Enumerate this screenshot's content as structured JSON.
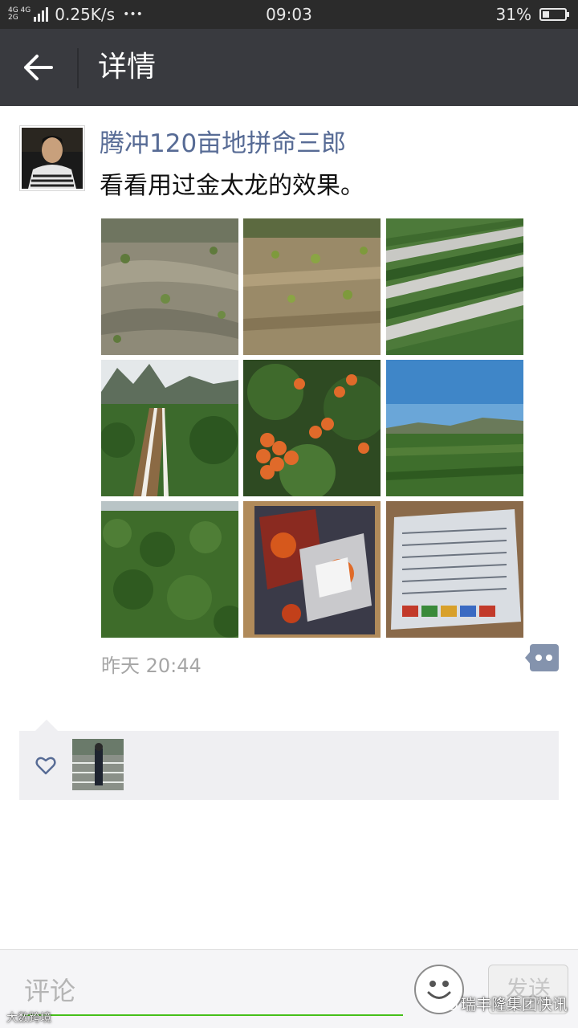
{
  "status_bar": {
    "network_top": "4G 4G",
    "network_bottom": "2G",
    "speed": "0.25K/s",
    "dots": "•••",
    "time": "09:03",
    "battery_percent": "31%",
    "battery_level": 0.31
  },
  "titlebar": {
    "back_icon": "arrow-left-icon",
    "title": "详情"
  },
  "post": {
    "author": "腾冲120亩地拼命三郎",
    "text": "看看用过金太龙的效果。",
    "photos": [
      {
        "label": "seedling field 1"
      },
      {
        "label": "seedling field 2"
      },
      {
        "label": "mulched rows"
      },
      {
        "label": "irrigation field"
      },
      {
        "label": "fruit cluster"
      },
      {
        "label": "green field under sky"
      },
      {
        "label": "dense plants"
      },
      {
        "label": "product packets box"
      },
      {
        "label": "product packet label"
      }
    ],
    "time": "昨天 20:44"
  },
  "likes": {
    "icon": "heart-outline-icon"
  },
  "comment_bar": {
    "placeholder": "评论",
    "send_label": "发送",
    "emoji_icon": "smiley-icon"
  },
  "watermark": {
    "right": "瑞丰隆集团快讯",
    "left": "大数跨境"
  },
  "colors": {
    "titlebar": "#393a3f",
    "name_link": "#576b95",
    "accent_green": "#45c01a"
  }
}
